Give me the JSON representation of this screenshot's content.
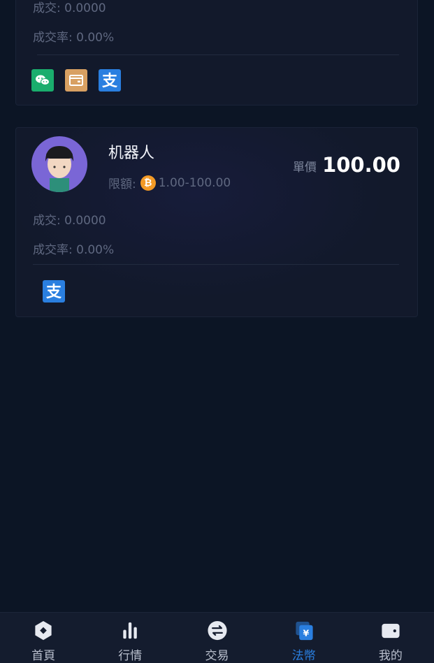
{
  "offers": [
    {
      "trades_label": "成交: 0.0000",
      "rate_label": "成交率: 0.00%",
      "payment_methods": [
        "wechat-pay-icon",
        "bank-card-icon",
        "alipay-icon"
      ]
    },
    {
      "name": "机器人",
      "limit_label": "限額:",
      "limit_range": "1.00-100.00",
      "coin_symbol": "₿",
      "price_label": "單價",
      "price": "100.00",
      "trades_label": "成交: 0.0000",
      "rate_label": "成交率: 0.00%",
      "payment_methods": [
        "alipay-icon"
      ]
    }
  ],
  "colors": {
    "accent": "#2a7fe0",
    "wechat": "#1aad6d",
    "card_pay": "#d8a062",
    "bitcoin": "#f39a26",
    "avatar_bg": "#7a66d6"
  },
  "nav": {
    "items": [
      {
        "label": "首頁",
        "icon": "home-icon"
      },
      {
        "label": "行情",
        "icon": "market-icon"
      },
      {
        "label": "交易",
        "icon": "trade-icon"
      },
      {
        "label": "法幣",
        "icon": "fiat-icon",
        "active": true
      },
      {
        "label": "我的",
        "icon": "wallet-icon"
      }
    ]
  }
}
